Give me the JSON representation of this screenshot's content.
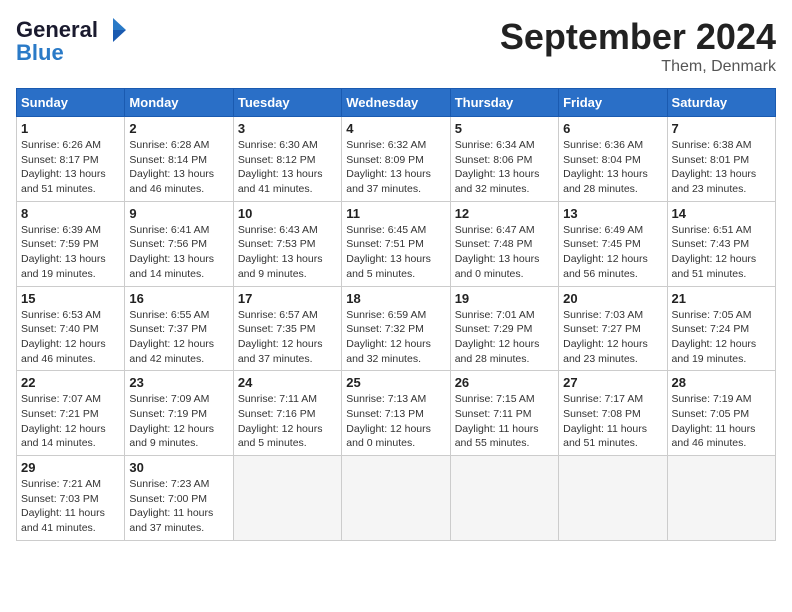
{
  "header": {
    "logo_line1": "General",
    "logo_line2": "Blue",
    "title": "September 2024",
    "subtitle": "Them, Denmark"
  },
  "columns": [
    "Sunday",
    "Monday",
    "Tuesday",
    "Wednesday",
    "Thursday",
    "Friday",
    "Saturday"
  ],
  "weeks": [
    [
      {
        "day": "1",
        "info": "Sunrise: 6:26 AM\nSunset: 8:17 PM\nDaylight: 13 hours\nand 51 minutes."
      },
      {
        "day": "2",
        "info": "Sunrise: 6:28 AM\nSunset: 8:14 PM\nDaylight: 13 hours\nand 46 minutes."
      },
      {
        "day": "3",
        "info": "Sunrise: 6:30 AM\nSunset: 8:12 PM\nDaylight: 13 hours\nand 41 minutes."
      },
      {
        "day": "4",
        "info": "Sunrise: 6:32 AM\nSunset: 8:09 PM\nDaylight: 13 hours\nand 37 minutes."
      },
      {
        "day": "5",
        "info": "Sunrise: 6:34 AM\nSunset: 8:06 PM\nDaylight: 13 hours\nand 32 minutes."
      },
      {
        "day": "6",
        "info": "Sunrise: 6:36 AM\nSunset: 8:04 PM\nDaylight: 13 hours\nand 28 minutes."
      },
      {
        "day": "7",
        "info": "Sunrise: 6:38 AM\nSunset: 8:01 PM\nDaylight: 13 hours\nand 23 minutes."
      }
    ],
    [
      {
        "day": "8",
        "info": "Sunrise: 6:39 AM\nSunset: 7:59 PM\nDaylight: 13 hours\nand 19 minutes."
      },
      {
        "day": "9",
        "info": "Sunrise: 6:41 AM\nSunset: 7:56 PM\nDaylight: 13 hours\nand 14 minutes."
      },
      {
        "day": "10",
        "info": "Sunrise: 6:43 AM\nSunset: 7:53 PM\nDaylight: 13 hours\nand 9 minutes."
      },
      {
        "day": "11",
        "info": "Sunrise: 6:45 AM\nSunset: 7:51 PM\nDaylight: 13 hours\nand 5 minutes."
      },
      {
        "day": "12",
        "info": "Sunrise: 6:47 AM\nSunset: 7:48 PM\nDaylight: 13 hours\nand 0 minutes."
      },
      {
        "day": "13",
        "info": "Sunrise: 6:49 AM\nSunset: 7:45 PM\nDaylight: 12 hours\nand 56 minutes."
      },
      {
        "day": "14",
        "info": "Sunrise: 6:51 AM\nSunset: 7:43 PM\nDaylight: 12 hours\nand 51 minutes."
      }
    ],
    [
      {
        "day": "15",
        "info": "Sunrise: 6:53 AM\nSunset: 7:40 PM\nDaylight: 12 hours\nand 46 minutes."
      },
      {
        "day": "16",
        "info": "Sunrise: 6:55 AM\nSunset: 7:37 PM\nDaylight: 12 hours\nand 42 minutes."
      },
      {
        "day": "17",
        "info": "Sunrise: 6:57 AM\nSunset: 7:35 PM\nDaylight: 12 hours\nand 37 minutes."
      },
      {
        "day": "18",
        "info": "Sunrise: 6:59 AM\nSunset: 7:32 PM\nDaylight: 12 hours\nand 32 minutes."
      },
      {
        "day": "19",
        "info": "Sunrise: 7:01 AM\nSunset: 7:29 PM\nDaylight: 12 hours\nand 28 minutes."
      },
      {
        "day": "20",
        "info": "Sunrise: 7:03 AM\nSunset: 7:27 PM\nDaylight: 12 hours\nand 23 minutes."
      },
      {
        "day": "21",
        "info": "Sunrise: 7:05 AM\nSunset: 7:24 PM\nDaylight: 12 hours\nand 19 minutes."
      }
    ],
    [
      {
        "day": "22",
        "info": "Sunrise: 7:07 AM\nSunset: 7:21 PM\nDaylight: 12 hours\nand 14 minutes."
      },
      {
        "day": "23",
        "info": "Sunrise: 7:09 AM\nSunset: 7:19 PM\nDaylight: 12 hours\nand 9 minutes."
      },
      {
        "day": "24",
        "info": "Sunrise: 7:11 AM\nSunset: 7:16 PM\nDaylight: 12 hours\nand 5 minutes."
      },
      {
        "day": "25",
        "info": "Sunrise: 7:13 AM\nSunset: 7:13 PM\nDaylight: 12 hours\nand 0 minutes."
      },
      {
        "day": "26",
        "info": "Sunrise: 7:15 AM\nSunset: 7:11 PM\nDaylight: 11 hours\nand 55 minutes."
      },
      {
        "day": "27",
        "info": "Sunrise: 7:17 AM\nSunset: 7:08 PM\nDaylight: 11 hours\nand 51 minutes."
      },
      {
        "day": "28",
        "info": "Sunrise: 7:19 AM\nSunset: 7:05 PM\nDaylight: 11 hours\nand 46 minutes."
      }
    ],
    [
      {
        "day": "29",
        "info": "Sunrise: 7:21 AM\nSunset: 7:03 PM\nDaylight: 11 hours\nand 41 minutes."
      },
      {
        "day": "30",
        "info": "Sunrise: 7:23 AM\nSunset: 7:00 PM\nDaylight: 11 hours\nand 37 minutes."
      },
      {
        "day": "",
        "info": ""
      },
      {
        "day": "",
        "info": ""
      },
      {
        "day": "",
        "info": ""
      },
      {
        "day": "",
        "info": ""
      },
      {
        "day": "",
        "info": ""
      }
    ]
  ]
}
